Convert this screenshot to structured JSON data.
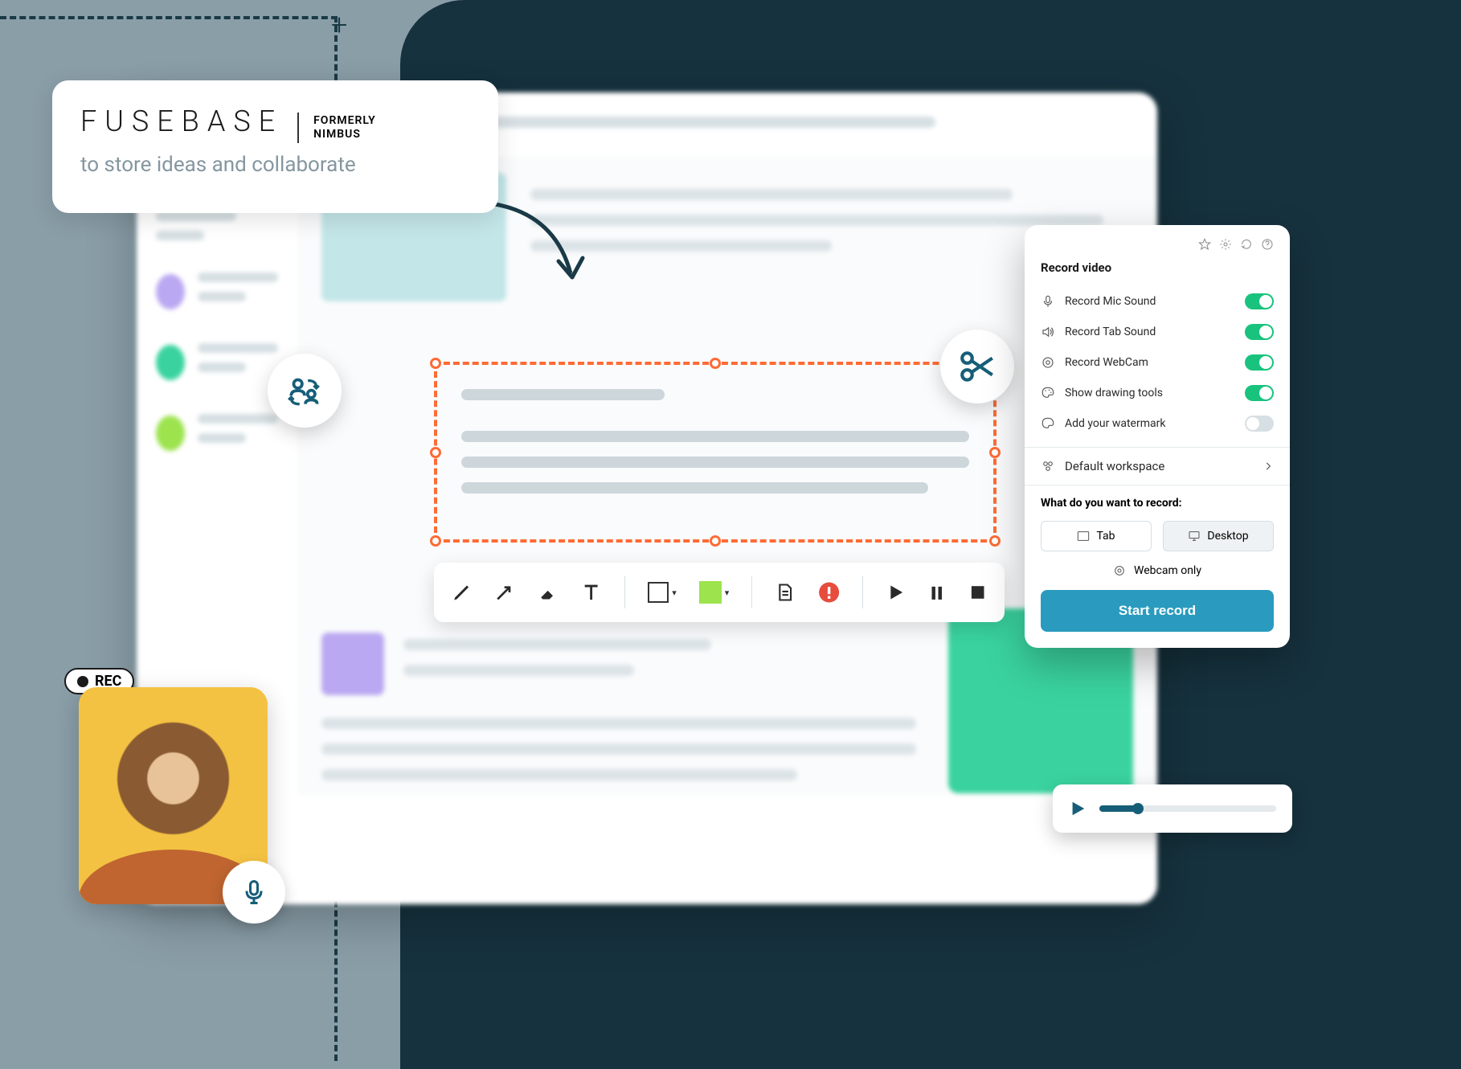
{
  "logo": {
    "brand": "FUSEBASE",
    "formerly_line1": "FORMERLY",
    "formerly_line2": "NIMBUS",
    "tagline": "to store ideas and collaborate"
  },
  "webcam": {
    "rec_label": "REC"
  },
  "record_panel": {
    "title": "Record video",
    "options": [
      {
        "label": "Record Mic Sound",
        "icon": "mic",
        "enabled": true
      },
      {
        "label": "Record Tab Sound",
        "icon": "speaker",
        "enabled": true
      },
      {
        "label": "Record WebCam",
        "icon": "camera",
        "enabled": true
      },
      {
        "label": "Show drawing tools",
        "icon": "palette",
        "enabled": true
      },
      {
        "label": "Add your watermark",
        "icon": "palette",
        "enabled": false
      }
    ],
    "workspace_label": "Default workspace",
    "question": "What do you want to record:",
    "modes": {
      "tab": "Tab",
      "desktop": "Desktop"
    },
    "webcam_only": "Webcam only",
    "start_button": "Start record"
  },
  "colors": {
    "accent": "#2a9bbf",
    "selection": "#ff6b35",
    "teal_dark": "#165e78"
  }
}
